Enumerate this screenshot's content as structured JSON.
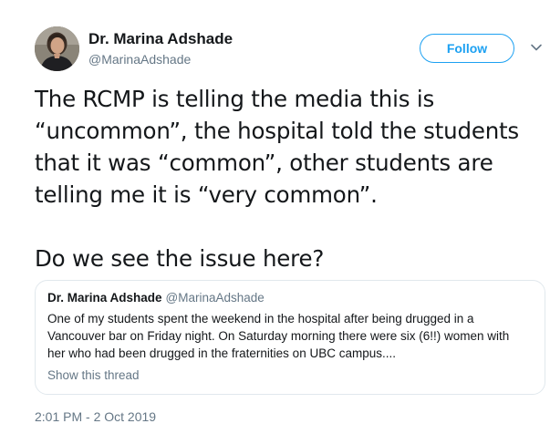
{
  "author": {
    "name": "Dr. Marina Adshade",
    "handle": "@MarinaAdshade",
    "avatar_icon": "profile-photo"
  },
  "header": {
    "follow_label": "Follow",
    "menu_icon": "chevron-down-icon"
  },
  "tweet": {
    "paragraphs": [
      "The RCMP is telling the media this is\n“uncommon”, the hospital told the students\nthat it was “common”, other students are\ntelling me it is “very common”.",
      "Do we see the issue here?"
    ]
  },
  "quote": {
    "name": "Dr. Marina Adshade",
    "handle": "@MarinaAdshade",
    "lines": [
      "One of my students spent the weekend in the hospital after being drugged in a",
      "Vancouver bar on Friday night. On Saturday morning there were six (6!!) women with",
      "her who had been drugged in the fraternities on UBC campus...."
    ],
    "show_thread_label": "Show this thread"
  },
  "timestamp": "2:01 PM - 2 Oct 2019",
  "colors": {
    "accent": "#1da1f2",
    "text": "#14171a",
    "secondary": "#657786",
    "border": "#e1e8ed"
  }
}
